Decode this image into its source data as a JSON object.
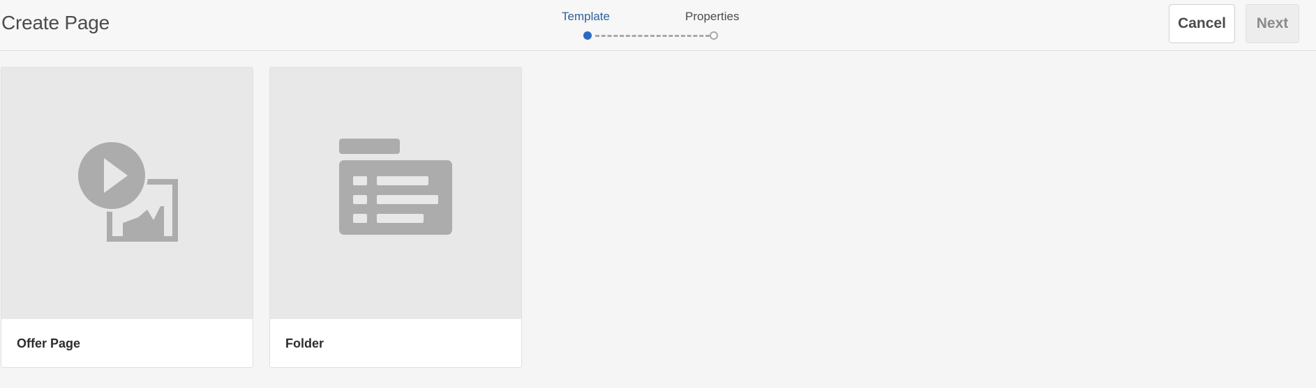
{
  "header": {
    "title": "Create Page",
    "wizard": {
      "steps": [
        {
          "label": "Template",
          "state": "active"
        },
        {
          "label": "Properties",
          "state": "pending"
        }
      ]
    },
    "cancel_label": "Cancel",
    "next_label": "Next"
  },
  "templates": [
    {
      "label": "Offer Page",
      "icon": "offer-page-icon"
    },
    {
      "label": "Folder",
      "icon": "folder-template-icon"
    }
  ],
  "colors": {
    "accent": "#2d6bc2",
    "active_step_text": "#2d5f9e",
    "icon_gray": "#acacac",
    "thumb_bg": "#e8e8e8"
  }
}
